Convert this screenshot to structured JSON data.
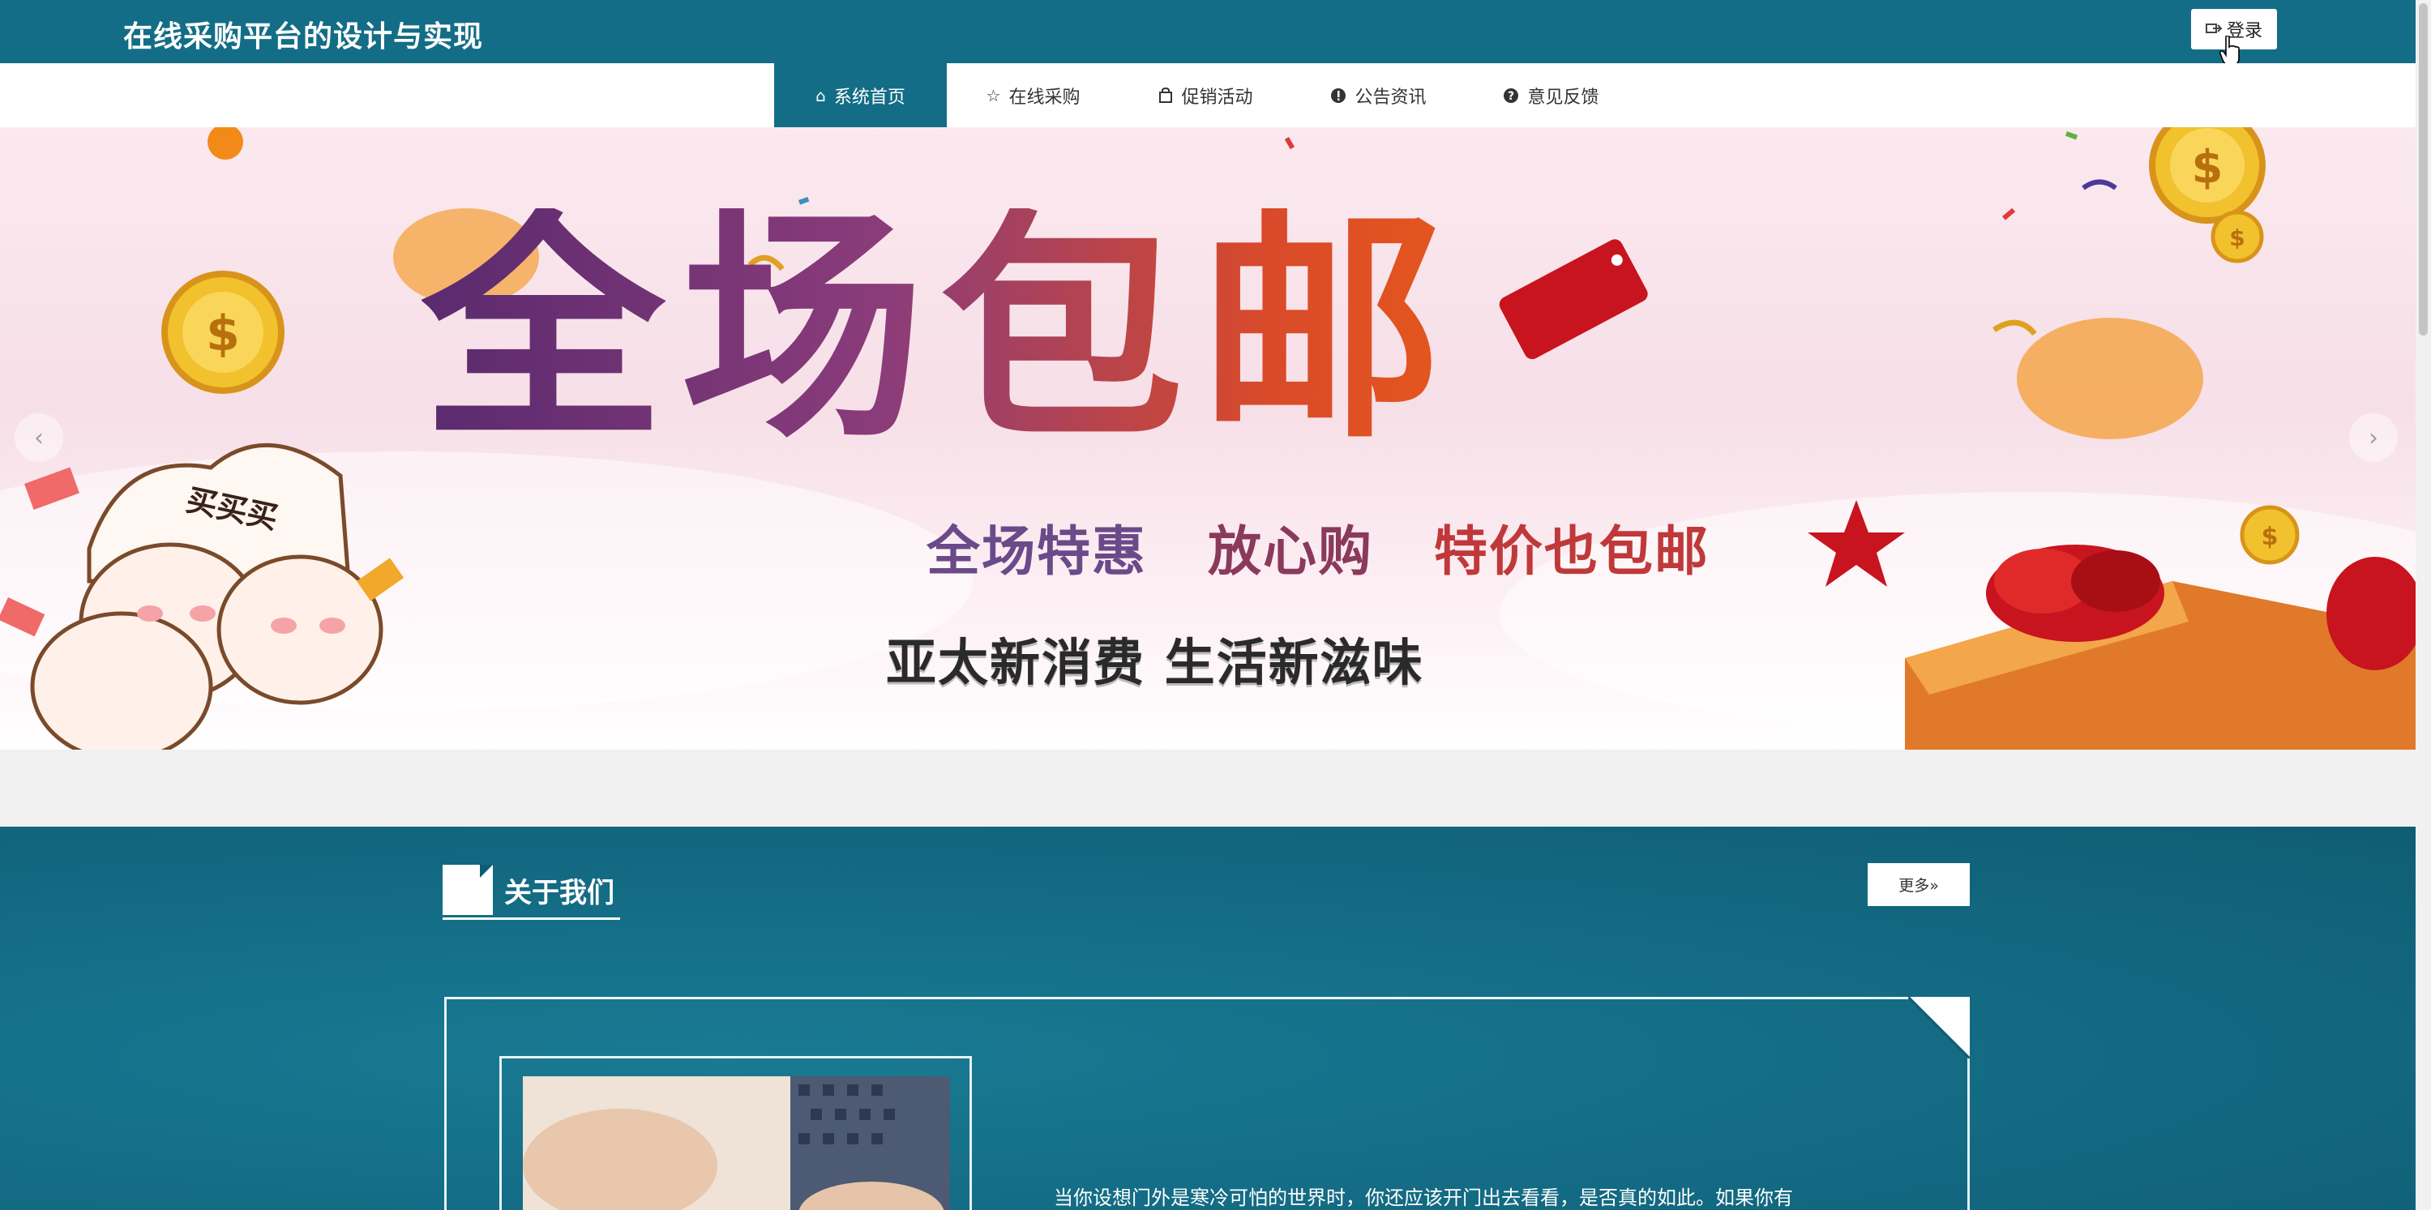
{
  "header": {
    "title": "在线采购平台的设计与实现",
    "login_label": "登录"
  },
  "nav": {
    "items": [
      {
        "label": "系统首页",
        "icon": "home-icon",
        "active": true
      },
      {
        "label": "在线采购",
        "icon": "star-icon",
        "active": false
      },
      {
        "label": "促销活动",
        "icon": "bag-icon",
        "active": false
      },
      {
        "label": "公告资讯",
        "icon": "info-icon",
        "active": false
      },
      {
        "label": "意见反馈",
        "icon": "question-icon",
        "active": false
      }
    ]
  },
  "banner": {
    "headline": "全场包邮",
    "tag": "包邮",
    "sub_part1": "全场特惠",
    "sub_part2": "放心购",
    "sub_part3": "特价也包邮",
    "slogan": "亚太新消费 生活新滋味",
    "buy_text": "买买买",
    "prev_icon": "chevron-left-icon",
    "next_icon": "chevron-right-icon"
  },
  "about": {
    "title": "关于我们",
    "more_label": "更多»",
    "text": "当你设想门外是寒冷可怕的世界时，你还应该开门出去看看，是否真的如此。如果你有"
  },
  "colors": {
    "primary": "#136d86",
    "white": "#ffffff"
  }
}
